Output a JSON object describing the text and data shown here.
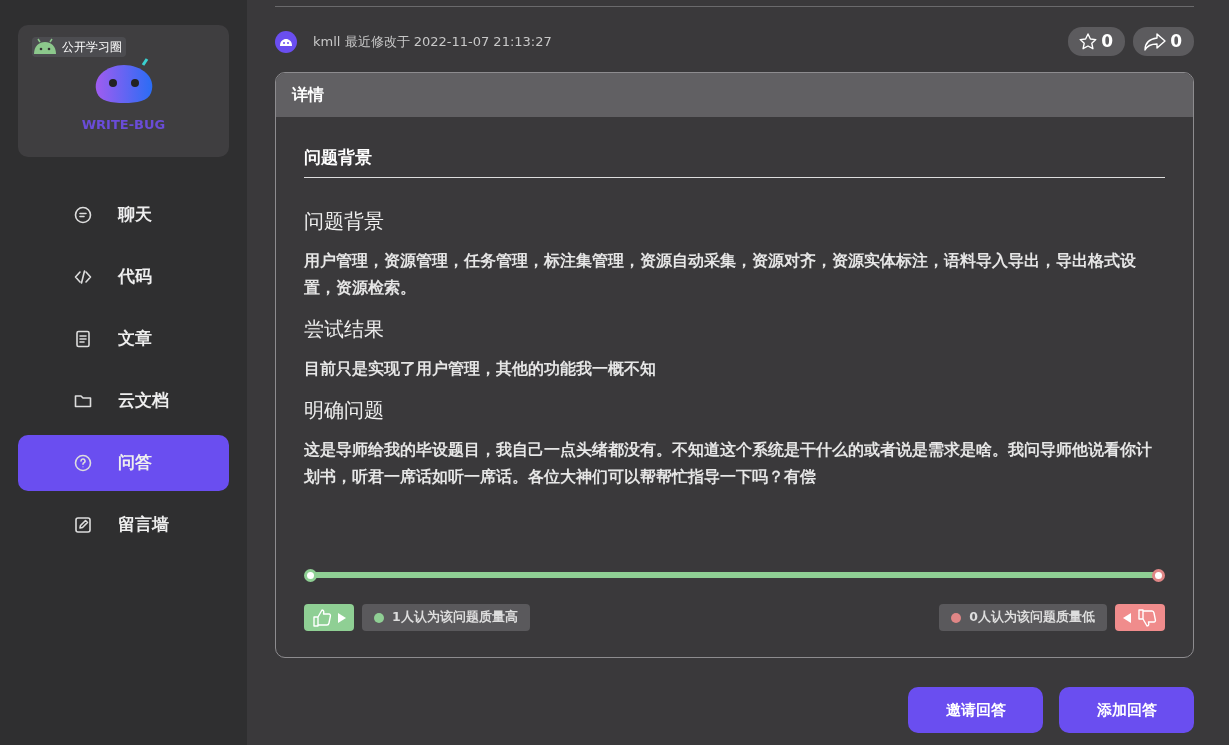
{
  "sidebar": {
    "logo": {
      "brand": "WRITE-BUG",
      "badge": "公开学习圈"
    },
    "items": [
      {
        "kind": "chat",
        "label": "聊天",
        "selected": false
      },
      {
        "kind": "code",
        "label": "代码",
        "selected": false
      },
      {
        "kind": "article",
        "label": "文章",
        "selected": false
      },
      {
        "kind": "folder",
        "label": "云文档",
        "selected": false
      },
      {
        "kind": "question",
        "label": "问答",
        "selected": true
      },
      {
        "kind": "edit",
        "label": "留言墙",
        "selected": false
      }
    ]
  },
  "meta": {
    "text": "kmll 最近修改于 2022-11-07 21:13:27",
    "stars": "0",
    "shares": "0"
  },
  "detail": {
    "header": "详情",
    "section_title": "问题背景",
    "blocks": [
      {
        "kind": "heading",
        "text": "问题背景"
      },
      {
        "kind": "paragraph",
        "text": "用户管理，资源管理，任务管理，标注集管理，资源自动采集，资源对齐，资源实体标注，语料导入导出，导出格式设置，资源检索。"
      },
      {
        "kind": "heading",
        "text": "尝试结果"
      },
      {
        "kind": "paragraph",
        "text": "目前只是实现了用户管理，其他的功能我一概不知"
      },
      {
        "kind": "heading",
        "text": "明确问题"
      },
      {
        "kind": "paragraph",
        "text": "这是导师给我的毕设题目，我自己一点头绪都没有。不知道这个系统是干什么的或者说是需求是啥。我问导师他说看你计划书，听君一席话如听一席话。各位大神们可以帮帮忙指导一下吗？有偿"
      }
    ],
    "quality": {
      "level": 1,
      "up_label": "1人认为该问题质量高",
      "down_label": "0人认为该问题质量低"
    }
  },
  "buttons": [
    {
      "label": "邀请回答"
    },
    {
      "label": "添加回答"
    }
  ]
}
